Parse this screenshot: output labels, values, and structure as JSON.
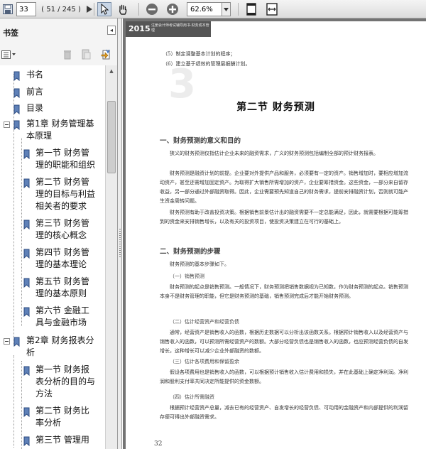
{
  "toolbar": {
    "current_page": "33",
    "page_count": "( 51 / 245 )",
    "zoom": "62.6%",
    "icons": [
      "save-icon",
      "next-page-icon",
      "select-tool-icon",
      "hand-tool-icon",
      "zoom-out-icon",
      "zoom-in-icon",
      "fit-page-icon",
      "fit-width-icon"
    ]
  },
  "panel": {
    "title": "书签",
    "collapse_glyph": "◂"
  },
  "bookmarks": [
    {
      "label": "书名"
    },
    {
      "label": "前言"
    },
    {
      "label": "目录"
    },
    {
      "label_lines": [
        "第1章  财务管理基",
        "本原理"
      ]
    },
    {
      "label_lines": [
        "第一节  财务管",
        "理的职能和组织"
      ]
    },
    {
      "label_lines": [
        "第二节  财务管",
        "理的目标与利益",
        "相关者的要求"
      ]
    },
    {
      "label_lines": [
        "第三节  财务管",
        "理的核心概念"
      ]
    },
    {
      "label_lines": [
        "第四节  财务管",
        "理的基本理论"
      ]
    },
    {
      "label_lines": [
        "第五节  财务管",
        "理的基本原则"
      ]
    },
    {
      "label_lines": [
        "第六节  金融工",
        "具与金融市场"
      ]
    },
    {
      "label_lines": [
        "第2章  财务报表分",
        "析"
      ]
    },
    {
      "label_lines": [
        "第一节  财务报",
        "表分析的目的与",
        "方法"
      ]
    },
    {
      "label_lines": [
        "第二节  财务比",
        "率分析"
      ]
    },
    {
      "label_lines": [
        "第三节  管理用"
      ]
    }
  ],
  "document": {
    "banner_year": "2015",
    "banner_sub": "注册会计师考试辅导用书·财务成本管理",
    "top_lines": [
      "（5）制定调整基本计划的程序；",
      "（6）建立基于绩效的管理层报酬计划。"
    ],
    "chapter_mark": "3",
    "section_title": "第二节  财务预测",
    "h_meaning": "一、财务预测的意义和目的",
    "p1": "狭义的财务预测仅指估计企业未来的融资需求，广义的财务预测包括编制全部的预计财务报表。",
    "p2": "财务预测是融资计划的前提。企业要对外提供产品和服务，必须要有一定的资产。销售增加时，要相应增加流动资产，甚至还需增加固定资产。为取得扩大销售所需增加的资产，企业要筹措资金。这些资金，一部分来自留存收益，另一部分通过外部融资取得。因此，企业需要预先知道自己的财务需求，提前安排融资计划，否则就可能产生资金周转问题。",
    "p3": "财务预测有助于改善投资决策。根据销售前景估计出的融资需要不一定总能满足，因此，就需要根据可能筹措到的资金来安排销售增长，以及有关的投资项目，使投资决策建立在可行的基础上。",
    "h_steps": "二、财务预测的步骤",
    "steps_intro": "财务预测的基本步骤如下。",
    "s1": "（一）销售预测",
    "s1_text": "财务预测的起点是销售预测。一般情况下，财务预测把销售数据视为已知数，作为财务预测的起点。销售预测本身不是财务管理的职能，但它是财务预测的基础，销售预测完成后才能开始财务预测。",
    "s2": "（二）估计经营资产和经营负债",
    "s2_text": "通常，经营资产是销售收入的函数，根据历史数据可以分析出该函数关系。根据预计销售收入以及经营资产与销售收入的函数，可以预测所需经营资产的数额。大部分经营负债也是销售收入的函数，也应预测经营负债的自发增长，这种增长可以减少企业外部融资的数额。",
    "s3": "（三）估计各项费用和保留盈余",
    "s3_text": "假设各项费用也是销售收入的函数，可以根据预计销售收入估计费用和损失，并在此基础上确定净利润。净利润和股利支付率共同决定所能提供的资金数额。",
    "s4": "（四）估计所需融资",
    "s4_text": "根据预计经营资产总量，减去已有的经营资产、自发增长的经营负债、可动用的金融资产和内部提供的利润留存便可得出外部融资需求。",
    "page_number": "32"
  }
}
